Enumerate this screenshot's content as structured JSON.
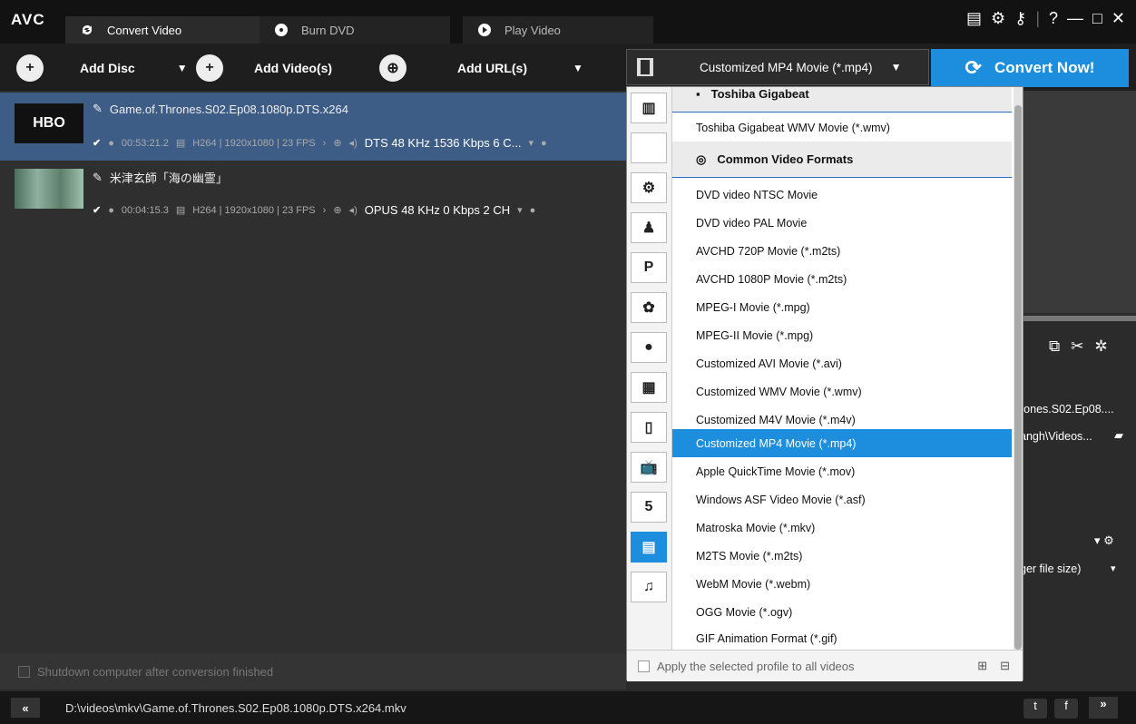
{
  "app": {
    "logo": "AVC"
  },
  "tabs": [
    {
      "label": "Convert Video"
    },
    {
      "label": "Burn DVD"
    },
    {
      "label": "Play Video"
    }
  ],
  "window_controls": {
    "help": "?",
    "minimize": "—",
    "maximize": "□",
    "close": "✕"
  },
  "toolbar": {
    "add_disc": "Add Disc",
    "add_videos": "Add Video(s)",
    "add_urls": "Add URL(s)",
    "format_selected": "Customized MP4 Movie (*.mp4)",
    "convert_now": "Convert Now!"
  },
  "files": [
    {
      "name": "Game.of.Thrones.S02.Ep08.1080p.DTS.x264",
      "thumb_text": "HBO",
      "duration": "00:53:21.2",
      "video_info": "H264 | 1920x1080 | 23 FPS",
      "audio": "DTS 48 KHz 1536 Kbps 6 C..."
    },
    {
      "name": "米津玄師「海の幽霊」",
      "duration": "00:04:15.3",
      "video_info": "H264 | 1920x1080 | 23 FPS",
      "audio": "OPUS 48 KHz 0 Kbps 2 CH"
    }
  ],
  "shutdown_label": "Shutdown computer after conversion finished",
  "status_path": "D:\\videos\\mkv\\Game.of.Thrones.S02.Ep08.1080p.DTS.x264.mkv",
  "right_panel": {
    "filename_partial": "rones.S02.Ep08....",
    "path_partial": "angh\\Videos...",
    "quality_partial": "ger file size)"
  },
  "dropdown": {
    "group_top": "Toshiba Gigabeat",
    "group_top_item": "Toshiba Gigabeat WMV Movie (*.wmv)",
    "group_common": "Common Video Formats",
    "items": [
      "DVD video NTSC Movie",
      "DVD video PAL Movie",
      "AVCHD 720P Movie (*.m2ts)",
      "AVCHD 1080P Movie (*.m2ts)",
      "MPEG-I Movie (*.mpg)",
      "MPEG-II Movie (*.mpg)",
      "Customized AVI Movie (*.avi)",
      "Customized WMV Movie (*.wmv)",
      "Customized M4V Movie (*.m4v)",
      "Customized MP4 Movie (*.mp4)",
      "Apple QuickTime Movie (*.mov)",
      "Windows ASF Video Movie (*.asf)",
      "Matroska Movie (*.mkv)",
      "M2TS Movie (*.m2ts)",
      "WebM Movie (*.webm)",
      "OGG Movie (*.ogv)",
      "GIF Animation Format (*.gif)"
    ],
    "selected_index": 9,
    "apply_label": "Apply the selected profile to all videos"
  },
  "colors": {
    "accent": "#1d8ddd",
    "selected_row": "#3d5d86"
  }
}
